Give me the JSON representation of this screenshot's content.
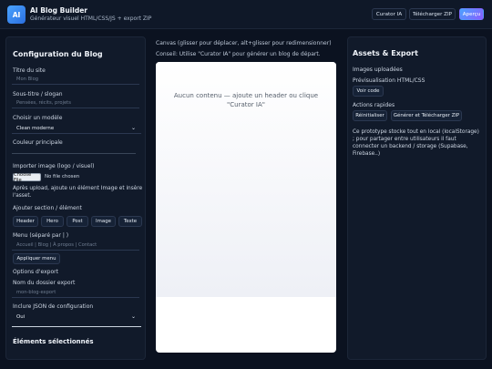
{
  "header": {
    "logo_text": "AI",
    "title": "AI Blog Builder",
    "subtitle": "Générateur visuel HTML/CSS/JS + export ZIP",
    "buttons": {
      "curator": "Curator IA",
      "download": "Télécharger ZIP",
      "preview": "Aperçu"
    }
  },
  "left": {
    "title": "Configuration du Blog",
    "site_title_label": "Titre du site",
    "site_title_placeholder": "Mon Blog",
    "subtitle_label": "Sous-titre / slogan",
    "subtitle_placeholder": "Pensées, récits, projets",
    "model_label": "Choisir un modèle",
    "model_value": "Clean moderne",
    "color_label": "Couleur principale",
    "import_label": "Importer image (logo / visuel)",
    "file_button": "Choose File",
    "file_status": "No file chosen",
    "upload_note": "Après upload, ajoute un élément Image et insère l'asset.",
    "add_section_label": "Ajouter section / élément",
    "section_buttons": [
      "Header",
      "Hero",
      "Post",
      "Image",
      "Texte"
    ],
    "menu_label": "Menu (séparé par | )",
    "menu_placeholder": "Accueil | Blog | À propos | Contact",
    "apply_menu": "Appliquer menu",
    "export_options_label": "Options d'export",
    "folder_label": "Nom du dossier export",
    "folder_placeholder": "mon-blog-export",
    "json_label": "Inclure JSON de configuration",
    "json_value": "Oui",
    "selected_title": "Éléments sélectionnés"
  },
  "center": {
    "hint1": "Canvas (glisser pour déplacer, alt+glisser pour redimensionner)",
    "hint2": "Conseil: Utilise \"Curator IA\" pour générer un blog de départ.",
    "empty_message": "Aucun contenu — ajoute un header ou clique \"Curator IA\""
  },
  "right": {
    "title": "Assets & Export",
    "uploaded_label": "Images uploadées",
    "preview_label": "Prévisualisation HTML/CSS",
    "view_code": "Voir code",
    "quick_actions_label": "Actions rapides",
    "reset": "Réinitialiser",
    "generate_download": "Générer et Télécharger ZIP",
    "note": "Ce prototype stocke tout en local (localStorage) ; pour partager entre utilisateurs il faut connecter un backend / storage (Supabase, Firebase..)"
  },
  "colors": {
    "background": "#0b1220",
    "panel": "#111a2a",
    "accent": "#4aa3ff",
    "accent2": "#8a5cff"
  }
}
